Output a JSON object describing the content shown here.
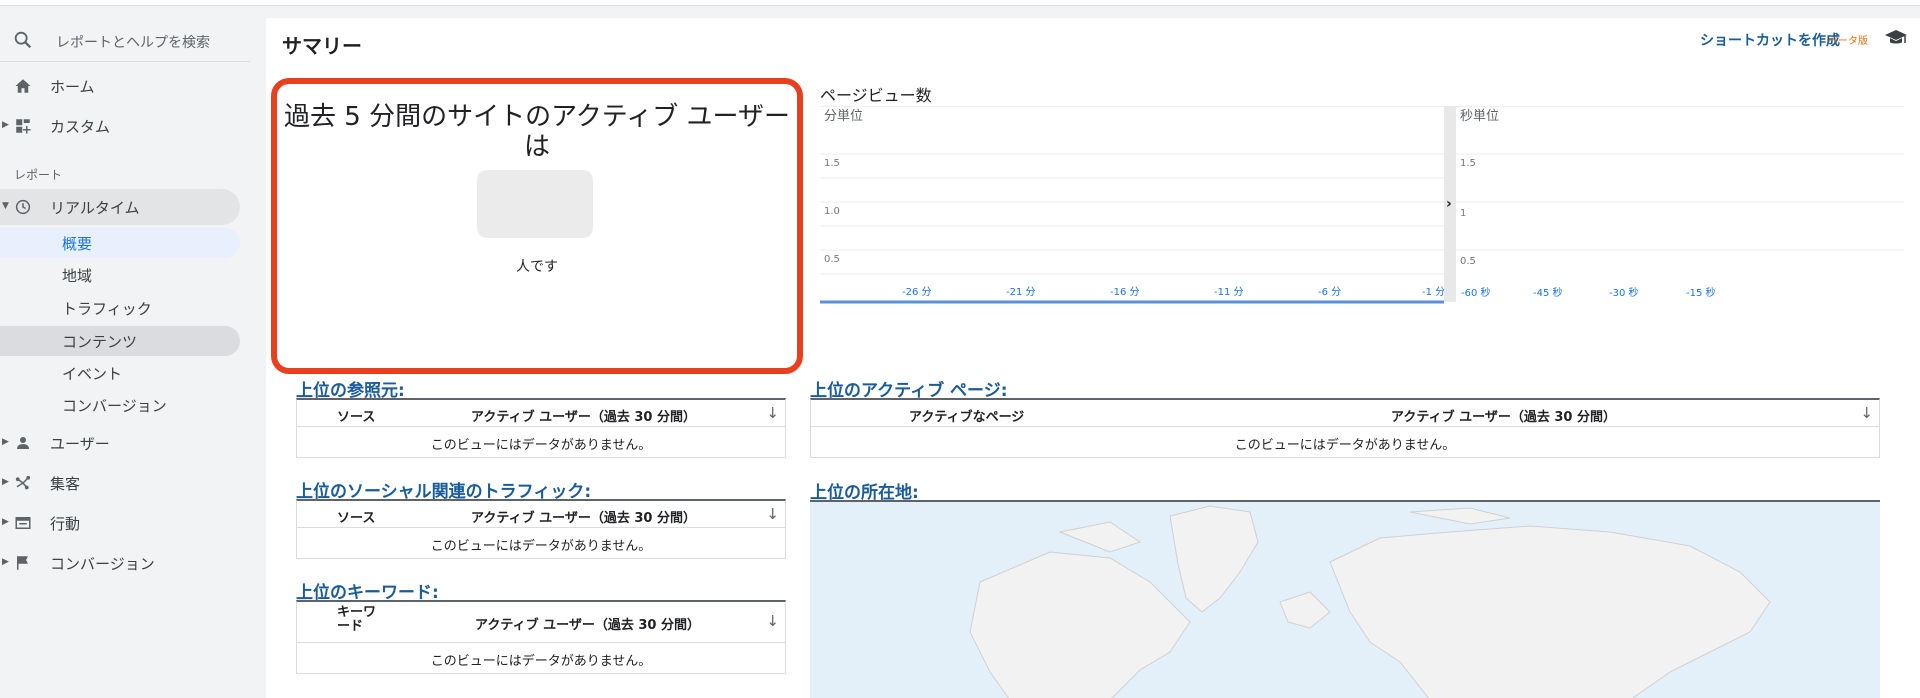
{
  "sidebar": {
    "search_placeholder": "レポートとヘルプを検索",
    "items": [
      {
        "label": "ホーム",
        "icon": "home-icon"
      },
      {
        "label": "カスタム",
        "icon": "dashboard-icon"
      }
    ],
    "section_label": "レポート",
    "realtime": {
      "label": "リアルタイム",
      "icon": "clock-icon"
    },
    "realtime_children": [
      "概要",
      "地域",
      "トラフィック",
      "コンテンツ",
      "イベント",
      "コンバージョン"
    ],
    "selected_child": "概要",
    "more_items": [
      {
        "label": "ユーザー",
        "icon": "person-icon"
      },
      {
        "label": "集客",
        "icon": "acquisition-icon"
      },
      {
        "label": "行動",
        "icon": "behavior-icon"
      },
      {
        "label": "コンバージョン",
        "icon": "flag-icon"
      }
    ]
  },
  "header": {
    "title": "サマリー",
    "shortcut_label": "ショートカットを作成",
    "beta_label": "ベータ版",
    "cap_icon": "graduation-cap-icon"
  },
  "active_users": {
    "title": "過去 5 分間のサイトのアクティブ ユーザーは",
    "suffix": "人です"
  },
  "pageviews": {
    "title": "ページビュー数",
    "left_label": "分単位",
    "right_label": "秒単位",
    "left_yticks": [
      "1.5",
      "1.0",
      "0.5"
    ],
    "right_yticks": [
      "1.5",
      "1",
      "0.5"
    ],
    "left_xticks": [
      "-26 分",
      "-21 分",
      "-16 分",
      "-11 分",
      "-6 分",
      "-1 分"
    ],
    "right_xticks": [
      "-60 秒",
      "-45 秒",
      "-30 秒",
      "-15 秒"
    ]
  },
  "referrers": {
    "title": "上位の参照元:",
    "col1": "ソース",
    "col2": "アクティブ ユーザー（過去 30 分間）",
    "empty": "このビューにはデータがありません。"
  },
  "social": {
    "title": "上位のソーシャル関連のトラフィック:",
    "col1": "ソース",
    "col2": "アクティブ ユーザー（過去 30 分間）",
    "empty": "このビューにはデータがありません。"
  },
  "keywords": {
    "title": "上位のキーワード:",
    "col1": "キーワード",
    "col2": "アクティブ ユーザー（過去 30 分間）",
    "empty": "このビューにはデータがありません。"
  },
  "active_pages": {
    "title": "上位のアクティブ ページ:",
    "col1": "アクティブなページ",
    "col2": "アクティブ ユーザー（過去 30 分間）",
    "empty": "このビューにはデータがありません。"
  },
  "locations": {
    "title": "上位の所在地:"
  },
  "colors": {
    "accent": "#1a73e8",
    "link": "#1a5b9a",
    "highlight": "#e8401f"
  }
}
